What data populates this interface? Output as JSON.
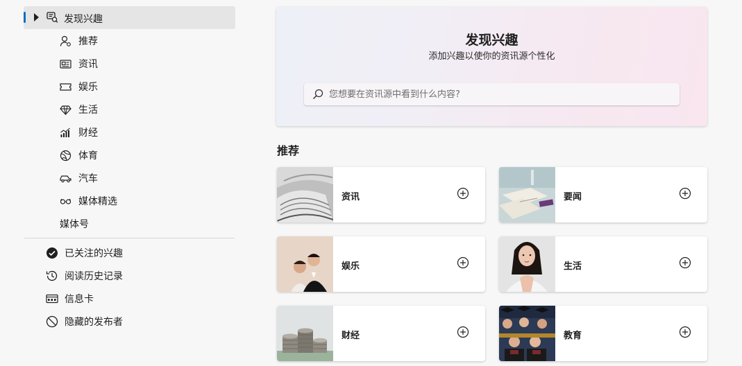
{
  "sidebar": {
    "header": {
      "label": "发现兴趣",
      "icon": "discover-icon"
    },
    "sub_items": [
      {
        "label": "推荐",
        "icon": "person-icon"
      },
      {
        "label": "资讯",
        "icon": "newspaper-icon"
      },
      {
        "label": "娱乐",
        "icon": "ticket-icon"
      },
      {
        "label": "生活",
        "icon": "diamond-icon"
      },
      {
        "label": "财经",
        "icon": "chart-icon"
      },
      {
        "label": "体育",
        "icon": "ball-icon"
      },
      {
        "label": "汽车",
        "icon": "car-icon"
      },
      {
        "label": "媒体精选",
        "icon": "glasses-icon"
      },
      {
        "label": "媒体号",
        "icon": ""
      }
    ],
    "sections": [
      {
        "label": "已关注的兴趣",
        "icon": "check-circle-icon"
      },
      {
        "label": "阅读历史记录",
        "icon": "history-icon"
      },
      {
        "label": "信息卡",
        "icon": "card-icon"
      },
      {
        "label": "隐藏的发布者",
        "icon": "block-icon"
      }
    ]
  },
  "hero": {
    "title": "发现兴趣",
    "subtitle": "添加兴趣以使你的资讯源个性化",
    "search_placeholder": "您想要在资讯源中看到什么内容?"
  },
  "recommend": {
    "title": "推荐",
    "cards": [
      {
        "label": "资讯",
        "thumb": "newspapers"
      },
      {
        "label": "要闻",
        "thumb": "desk-papers"
      },
      {
        "label": "娱乐",
        "thumb": "couple"
      },
      {
        "label": "生活",
        "thumb": "woman"
      },
      {
        "label": "财经",
        "thumb": "coins"
      },
      {
        "label": "教育",
        "thumb": "graduates"
      }
    ]
  },
  "colors": {
    "accent": "#0f6cbd",
    "hero_left": "#eef0f7",
    "hero_right": "#f9e6ef"
  }
}
